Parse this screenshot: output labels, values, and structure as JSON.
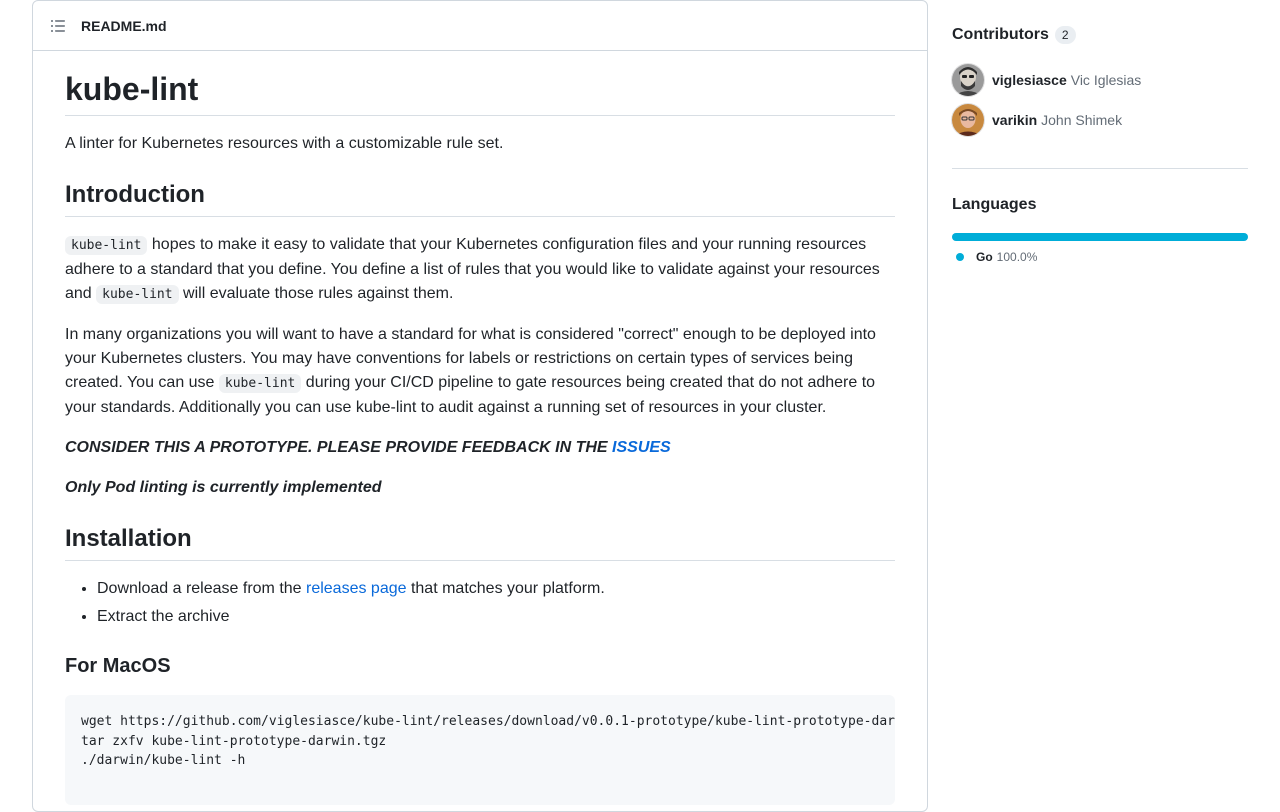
{
  "readme": {
    "filename": "README.md",
    "title": "kube-lint",
    "tagline": "A linter for Kubernetes resources with a customizable rule set.",
    "intro_heading": "Introduction",
    "intro_p1": {
      "code1": "kube-lint",
      "text1": " hopes to make it easy to validate that your Kubernetes configuration files and your running resources adhere to a standard that you define. You define a list of rules that you would like to validate against your resources and ",
      "code2": "kube-lint",
      "text2": " will evaluate those rules against them."
    },
    "intro_p2": {
      "text1": "In many organizations you will want to have a standard for what is considered \"correct\" enough to be deployed into your Kubernetes clusters. You may have conventions for labels or restrictions on certain types of services being created. You can use ",
      "code1": "kube-lint",
      "text2": " during your CI/CD pipeline to gate resources being created that do not adhere to your standards. Additionally you can use kube-lint to audit against a running set of resources in your cluster."
    },
    "prototype_notice": "CONSIDER THIS A PROTOTYPE. PLEASE PROVIDE FEEDBACK IN THE ",
    "issues_link": "ISSUES",
    "pod_notice": "Only Pod linting is currently implemented",
    "install_heading": "Installation",
    "install_items": {
      "item1_before": "Download a release from the ",
      "item1_link": "releases page",
      "item1_after": " that matches your platform.",
      "item2": "Extract the archive"
    },
    "macos_heading": "For MacOS",
    "macos_code": "wget https://github.com/viglesiasce/kube-lint/releases/download/v0.0.1-prototype/kube-lint-prototype-darwin.tgz\ntar zxfv kube-lint-prototype-darwin.tgz\n./darwin/kube-lint -h"
  },
  "sidebar": {
    "contributors_title": "Contributors",
    "contributors_count": "2",
    "contributors": [
      {
        "login": "viglesiasce",
        "name": "Vic Iglesias"
      },
      {
        "login": "varikin",
        "name": "John Shimek"
      }
    ],
    "languages_title": "Languages",
    "languages": [
      {
        "name": "Go",
        "percent": "100.0%",
        "fraction": 1.0,
        "color": "#00ADD8"
      }
    ]
  }
}
